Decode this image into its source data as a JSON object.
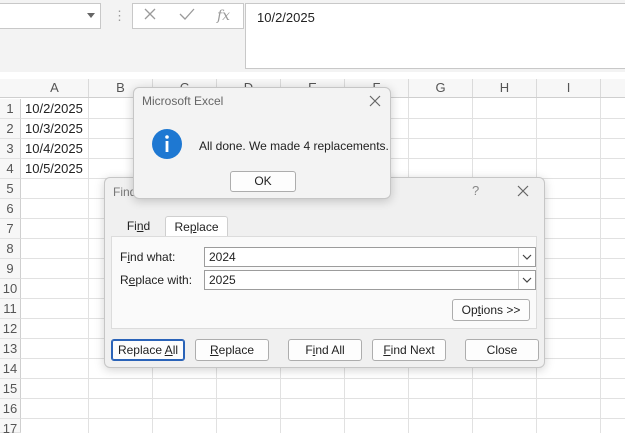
{
  "formula_bar": {
    "cancel_icon": "x-icon",
    "enter_icon": "check-icon",
    "fx_label": "fx",
    "content": "10/2/2025"
  },
  "columns": [
    "A",
    "B",
    "C",
    "D",
    "E",
    "F",
    "G",
    "H",
    "I"
  ],
  "rows": [
    "1",
    "2",
    "3",
    "4",
    "5",
    "6",
    "7",
    "8",
    "9",
    "10",
    "11",
    "12",
    "13",
    "14",
    "15",
    "16",
    "17"
  ],
  "cells": {
    "A1": "10/2/2025",
    "A2": "10/3/2025",
    "A3": "10/4/2025",
    "A4": "10/5/2025"
  },
  "find_replace_dialog": {
    "title": "Find and Replace",
    "help": "?",
    "tabs": [
      "Find",
      "Replace"
    ],
    "active_tab": "Replace",
    "find_label": "Find what:",
    "find_value": "2024",
    "replace_label": "Replace with:",
    "replace_value": "2025",
    "options_button": "Options >>",
    "buttons": {
      "replace_all": "Replace All",
      "replace": "Replace",
      "find_all": "Find All",
      "find_next": "Find Next",
      "close": "Close"
    }
  },
  "message_box": {
    "title": "Microsoft Excel",
    "message": "All done. We made 4 replacements.",
    "ok": "OK",
    "icon": "info-icon"
  },
  "colors": {
    "info_blue": "#1e78d2",
    "default_button_border": "#2a63b8"
  }
}
